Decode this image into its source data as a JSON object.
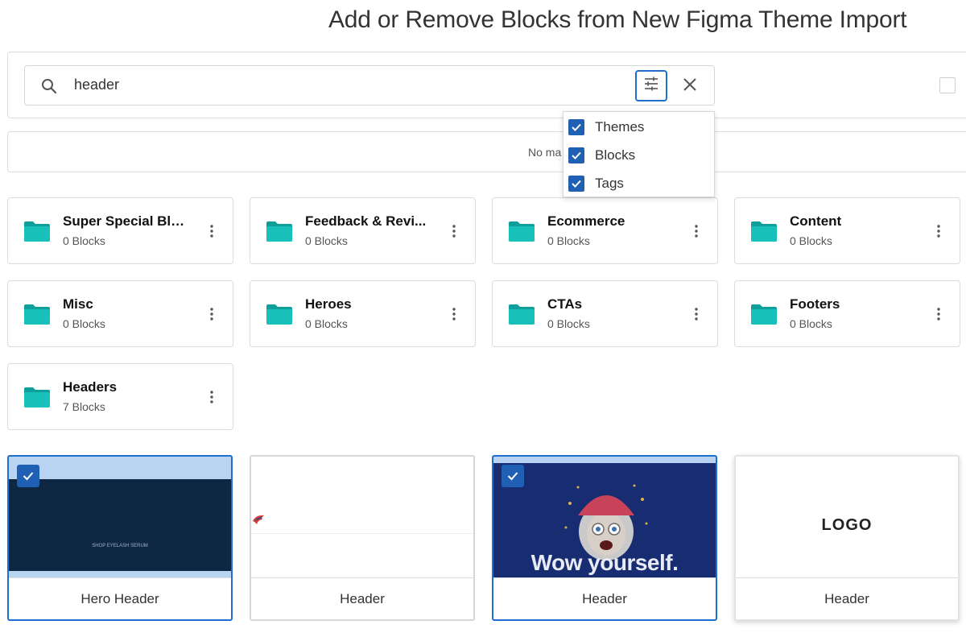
{
  "page": {
    "title": "Add or Remove Blocks from New Figma Theme Import"
  },
  "search": {
    "query": "header"
  },
  "no_match": {
    "text": "No ma"
  },
  "filter_options": [
    {
      "label": "Themes",
      "checked": true
    },
    {
      "label": "Blocks",
      "checked": true
    },
    {
      "label": "Tags",
      "checked": true
    }
  ],
  "folders": [
    {
      "name": "Super Special Blo...",
      "count": "0 Blocks"
    },
    {
      "name": "Feedback & Revi...",
      "count": "0 Blocks"
    },
    {
      "name": "Ecommerce",
      "count": "0 Blocks"
    },
    {
      "name": "Content",
      "count": "0 Blocks"
    },
    {
      "name": "Misc",
      "count": "0 Blocks"
    },
    {
      "name": "Heroes",
      "count": "0 Blocks"
    },
    {
      "name": "CTAs",
      "count": "0 Blocks"
    },
    {
      "name": "Footers",
      "count": "0 Blocks"
    },
    {
      "name": "Headers",
      "count": "7 Blocks"
    }
  ],
  "blocks": [
    {
      "label": "Hero Header",
      "selected": true,
      "thumb_text": "SHOP EYELASH SERUM"
    },
    {
      "label": "Header",
      "selected": false
    },
    {
      "label": "Header",
      "selected": true,
      "thumb_text": "Wow yourself."
    },
    {
      "label": "Header",
      "selected": false,
      "thumb_text": "LOGO"
    }
  ],
  "colors": {
    "accent": "#1f6fd0",
    "checkbox": "#1f5fb4",
    "folder": "#14b8b2",
    "hero_bg": "#0e2742",
    "wow_bg": "#182c72"
  }
}
